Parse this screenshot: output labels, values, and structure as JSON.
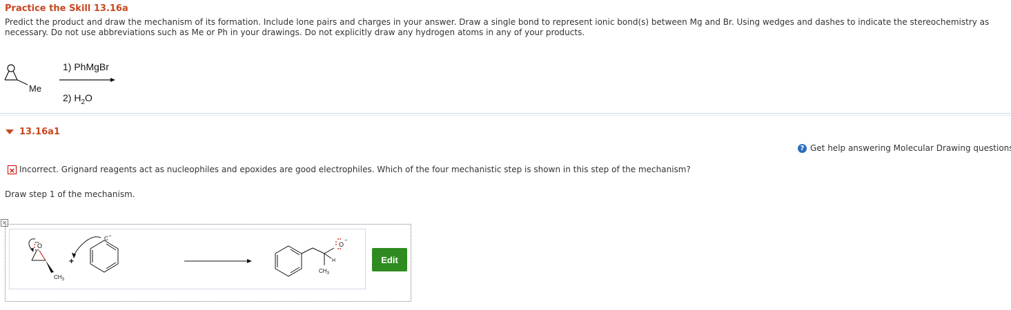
{
  "header": {
    "title": "Practice the Skill 13.16a",
    "instructions": "Predict the product and draw the mechanism of its formation. Include lone pairs and charges in your answer. Draw a single bond to represent ionic bond(s) between Mg and Br. Using wedges and dashes to indicate the stereochemistry as necessary. Do not use abbreviations such as Me or Ph in your drawings. Do not explicitly draw any hydrogen atoms in any of your products."
  },
  "reaction": {
    "reagent1": "1) PhMgBr",
    "reagent2_prefix": "2) H",
    "reagent2_sub": "2",
    "reagent2_suffix": "O",
    "substituent_label": "Me",
    "oxygen_label": "O"
  },
  "part": {
    "label": "13.16a1"
  },
  "help": {
    "label": "Get help answering Molecular Drawing questions",
    "icon": "?"
  },
  "feedback": {
    "icon": "×",
    "text": "Incorrect. Grignard reagents act as nucleophiles and epoxides are good electrophiles. Which of the four mechanistic step is shown in this step of the mechanism?"
  },
  "step": {
    "text": "Draw step 1 of the mechanism."
  },
  "drawing": {
    "minimize_icon": "×",
    "ch3_left": "CH",
    "ch3_left_sub": "3",
    "carbanion_label": "C",
    "carbanion_charge": "−",
    "plus_sign": "+",
    "product_oxygen": "O",
    "product_charge": "−",
    "product_h": "H",
    "product_ch3": "CH",
    "product_ch3_sub": "3",
    "epoxide_oxygen": "O"
  },
  "edit_button": {
    "label": "Edit",
    "color": "#2e8b20"
  }
}
